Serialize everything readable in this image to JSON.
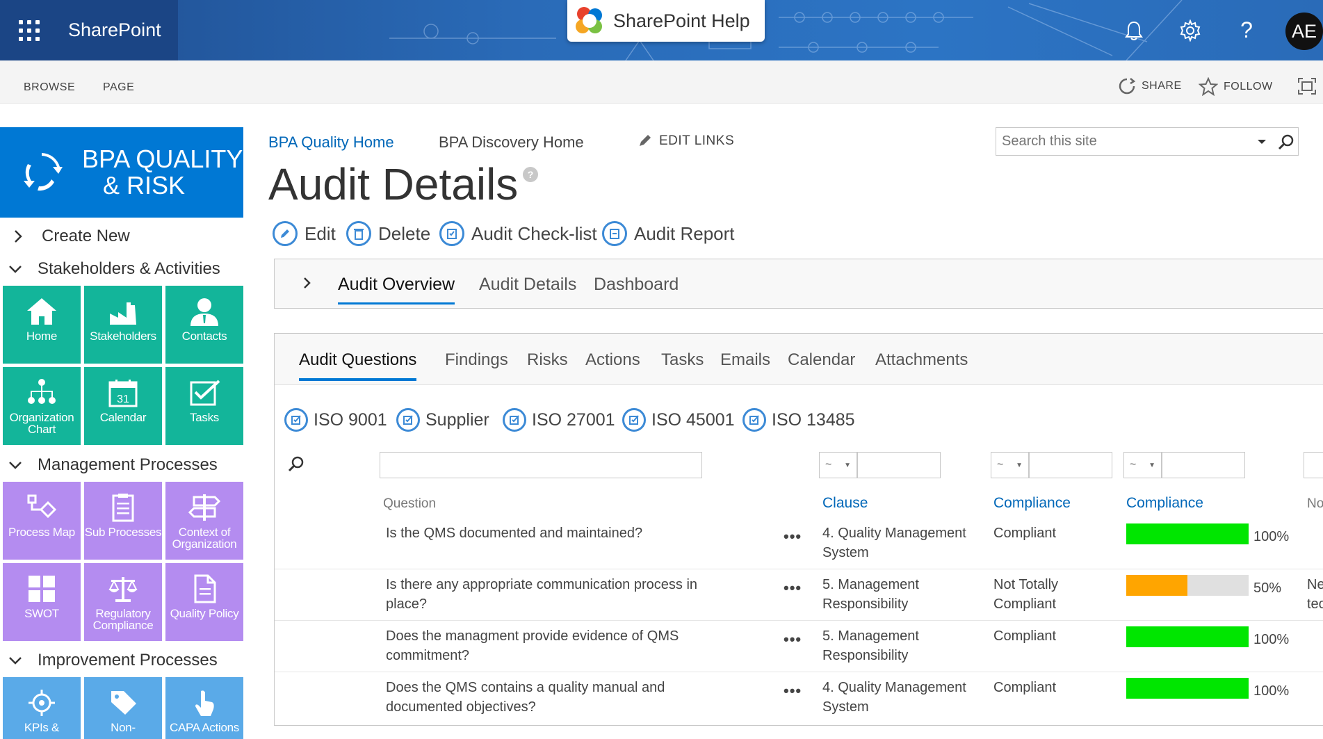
{
  "suite": {
    "brand": "SharePoint",
    "help_popup": "SharePoint Help",
    "avatar": "AE",
    "icons": [
      "waffle-icon",
      "bell-icon",
      "gear-icon",
      "question-icon"
    ]
  },
  "ribbon": {
    "tabs": [
      "BROWSE",
      "PAGE"
    ],
    "share": "SHARE",
    "follow": "FOLLOW"
  },
  "site": {
    "logo_line1": "BPA QUALITY",
    "logo_line2": "& RISK"
  },
  "nav": {
    "sections": [
      {
        "label": "Create New"
      },
      {
        "label": "Stakeholders & Activities",
        "tiles": [
          "Home",
          "Stakeholders",
          "Contacts",
          "Organization Chart",
          "Calendar",
          "Tasks"
        ]
      },
      {
        "label": "Management Processes",
        "tiles": [
          "Process Map",
          "Sub Processes",
          "Context of Organization",
          "SWOT",
          "Regulatory Compliance",
          "Quality Policy"
        ]
      },
      {
        "label": "Improvement Processes",
        "tiles": [
          "KPIs &",
          "Non-",
          "CAPA Actions"
        ]
      }
    ]
  },
  "topnav": {
    "links": [
      "BPA Quality Home",
      "BPA Discovery Home"
    ],
    "edit_links": "EDIT LINKS"
  },
  "search": {
    "placeholder": "Search this site"
  },
  "page": {
    "title": "Audit Details",
    "help": "?"
  },
  "actions": [
    "Edit",
    "Delete",
    "Audit Check-list",
    "Audit Report"
  ],
  "tabs_top": [
    "Audit Overview",
    "Audit Details",
    "Dashboard"
  ],
  "tabs_bottom": [
    "Audit Questions",
    "Findings",
    "Risks",
    "Actions",
    "Tasks",
    "Emails",
    "Calendar",
    "Attachments"
  ],
  "standards": [
    "ISO 9001",
    "Supplier",
    "ISO 27001",
    "ISO 45001",
    "ISO 13485"
  ],
  "table": {
    "filter_op": "~",
    "headers": {
      "question": "Question",
      "clause": "Clause",
      "compliance": "Compliance",
      "compliance_bar": "Compliance",
      "next": "No"
    },
    "rows": [
      {
        "question": "Is the QMS documented and maintained?",
        "clause": "4. Quality Management System",
        "compliance": "Compliant",
        "percent": 1.0,
        "percent_label": "100%",
        "color": "#00e600",
        "extra": ""
      },
      {
        "question": "Is there any appropriate communication process in place?",
        "clause": "5. Management Responsibility",
        "compliance": "Not Totally Compliant",
        "percent": 0.5,
        "percent_label": "50%",
        "color": "#ffa500",
        "extra": "Ne tec"
      },
      {
        "question": "Does the managment provide evidence of QMS commitment?",
        "clause": "5. Management Responsibility",
        "compliance": "Compliant",
        "percent": 1.0,
        "percent_label": "100%",
        "color": "#00e600",
        "extra": ""
      },
      {
        "question": "Does the QMS contains a quality manual and documented objectives?",
        "clause": "4. Quality Management System",
        "compliance": "Compliant",
        "percent": 1.0,
        "percent_label": "100%",
        "color": "#00e600",
        "extra": ""
      }
    ]
  },
  "colors": {
    "accent": "#0078d4",
    "green_tile": "#13b59a",
    "purple_tile": "#b48cf0",
    "blue_tile": "#5aaae8"
  }
}
